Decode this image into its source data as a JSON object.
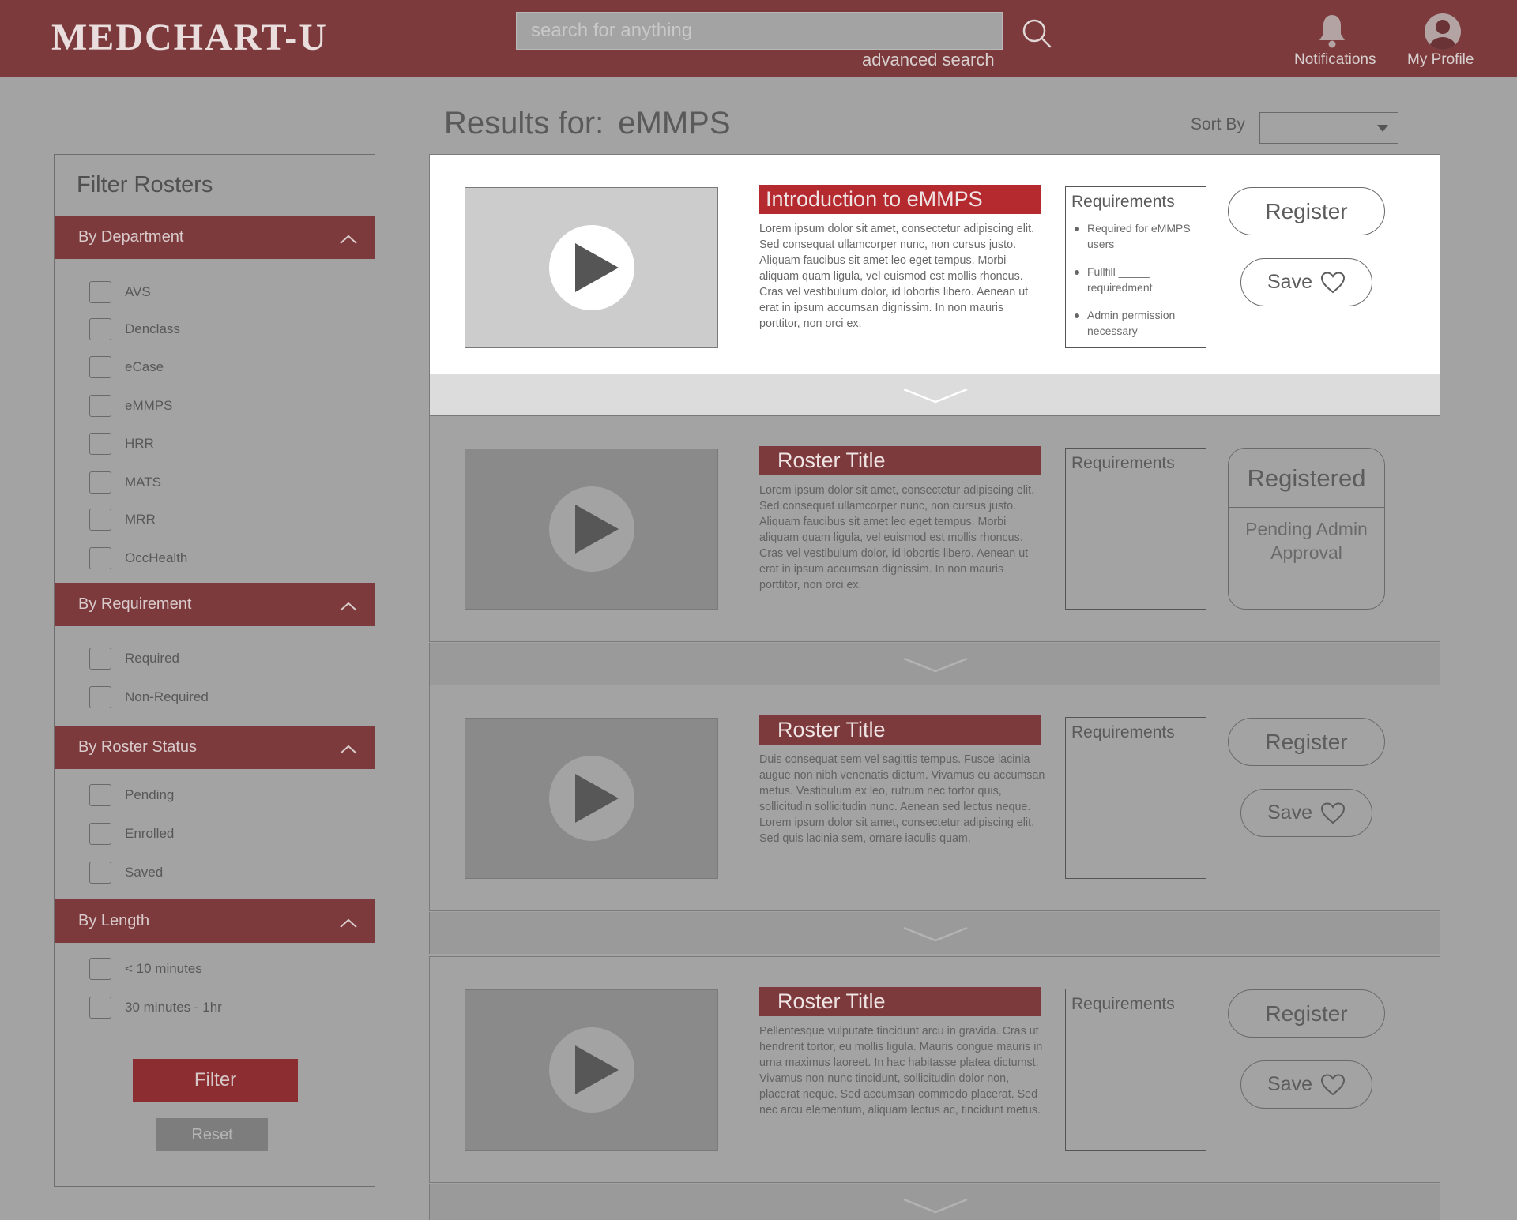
{
  "header": {
    "logo": "MEDCHART-U",
    "search_placeholder": "search for anything",
    "advanced_search": "advanced search",
    "notifications_label": "Notifications",
    "profile_label": "My Profile"
  },
  "results": {
    "prefix": "Results for:",
    "query": "eMMPS",
    "sort_label": "Sort By"
  },
  "sidebar": {
    "title": "Filter Rosters",
    "sections": [
      {
        "title": "By Department",
        "options": [
          "AVS",
          "Denclass",
          "eCase",
          "eMMPS",
          "HRR",
          "MATS",
          "MRR",
          "OccHealth"
        ]
      },
      {
        "title": "By Requirement",
        "options": [
          "Required",
          "Non-Required"
        ]
      },
      {
        "title": "By Roster Status",
        "options": [
          "Pending",
          "Enrolled",
          "Saved"
        ]
      },
      {
        "title": "By Length",
        "options": [
          "< 10 minutes",
          "30 minutes - 1hr"
        ]
      }
    ],
    "filter_label": "Filter",
    "reset_label": "Reset"
  },
  "cards": [
    {
      "title": "Introduction to eMMPS",
      "description": "Lorem ipsum dolor sit amet, consectetur adipiscing elit. Sed consequat ullamcorper nunc, non cursus justo. Aliquam faucibus sit amet leo eget tempus. Morbi aliquam quam ligula, vel euismod est mollis rhoncus. Cras vel vestibulum dolor, id lobortis libero. Aenean ut erat in ipsum accumsan dignissim. In non mauris porttitor,  non orci ex.",
      "requirements_title": "Requirements",
      "requirements": [
        "Required for eMMPS users",
        "Fullfill _____ requiredment",
        "Admin permission necessary"
      ],
      "register_label": "Register",
      "save_label": "Save"
    },
    {
      "title": "Roster Title",
      "description": "Lorem ipsum dolor sit amet, consectetur adipiscing elit. Sed consequat ullamcorper nunc, non cursus justo. Aliquam faucibus sit amet leo eget tempus. Morbi aliquam quam ligula, vel euismod est mollis rhoncus. Cras vel vestibulum dolor, id lobortis libero. Aenean ut erat in ipsum accumsan dignissim. In non mauris porttitor,  non orci ex.",
      "requirements_title": "Requirements",
      "status_title": "Registered",
      "status_sub": "Pending Admin Approval"
    },
    {
      "title": "Roster Title",
      "description": "Duis consequat sem vel sagittis tempus. Fusce lacinia augue non nibh venenatis dictum. Vivamus eu accumsan metus. Vestibulum ex leo, rutrum nec tortor quis, sollicitudin sollicitudin nunc. Aenean sed lectus neque. Lorem ipsum dolor sit amet, consectetur adipiscing elit. Sed quis lacinia sem, ornare iaculis quam.",
      "requirements_title": "Requirements",
      "register_label": "Register",
      "save_label": "Save"
    },
    {
      "title": "Roster Title",
      "description": "Pellentesque vulputate tincidunt arcu in gravida. Cras ut hendrerit tortor, eu mollis ligula. Mauris congue mauris in urna maximus laoreet. In hac habitasse platea dictumst. Vivamus non nunc tincidunt, sollicitudin dolor non, placerat neque. Sed accumsan commodo placerat. Sed nec arcu elementum, aliquam lectus ac, tincidunt metus.",
      "requirements_title": "Requirements",
      "register_label": "Register",
      "save_label": "Save"
    }
  ],
  "colors": {
    "brand": "#7d3a3c",
    "accent_red": "#b52a2f",
    "filter_button": "#8b2d31",
    "background": "#a3a3a3"
  }
}
